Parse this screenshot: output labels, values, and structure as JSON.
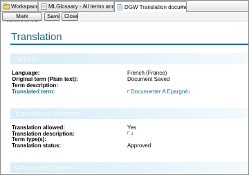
{
  "tabs": [
    {
      "label": "Workspace",
      "icon": "workspace-icon",
      "active": false
    },
    {
      "label": "MLGlossary - All terms and...",
      "icon": "glossary-icon",
      "active": false
    },
    {
      "label": "DGW Translation document",
      "icon": "document-icon",
      "active": true
    }
  ],
  "tab_close_glyph": "×",
  "toolbar": {
    "mark_unapproved_label": "Mark Unapproved",
    "save_label": "Save",
    "close_label": "Close"
  },
  "page": {
    "title": "Translation"
  },
  "sections": {
    "details": {
      "label": "Details",
      "rows": [
        {
          "label": "Language:",
          "value": "French (France)"
        },
        {
          "label": "Original term (Plain text):",
          "value": "Document Saved"
        },
        {
          "label": "Term description:",
          "value": ""
        },
        {
          "label": "Translated term:",
          "value": "Documenter A Epargné"
        }
      ]
    },
    "translation_settings": {
      "label": "Translation Settings",
      "rows": [
        {
          "label": "Translation allowed:",
          "value": "Yes"
        },
        {
          "label": "Translation description:",
          "value": ""
        },
        {
          "label": "Term type(s):",
          "value": ""
        },
        {
          "label": "Translation status:",
          "value": "Approved"
        }
      ]
    },
    "advanced_options": {
      "label": "Advanced Options"
    }
  },
  "colors": {
    "title": "#15677f",
    "rule": "#1e7190",
    "band": "#d9ecf7",
    "link": "#1d6f8c"
  }
}
